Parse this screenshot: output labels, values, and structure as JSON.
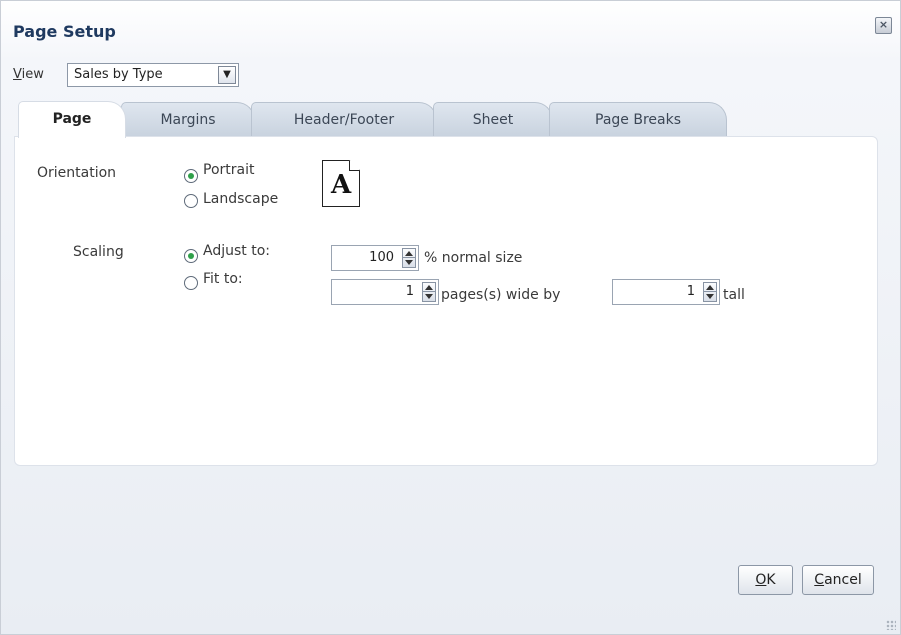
{
  "dialog": {
    "title": "Page Setup",
    "close_label": "×"
  },
  "view": {
    "label_prefix": "V",
    "label_rest": "iew",
    "selected": "Sales by Type",
    "dropdown_arrow": "chevron-down-icon"
  },
  "tabs": [
    {
      "label": "Page",
      "active": true
    },
    {
      "label": "Margins",
      "active": false
    },
    {
      "label": "Header/Footer",
      "active": false
    },
    {
      "label": "Sheet",
      "active": false
    },
    {
      "label": "Page Breaks",
      "active": false
    }
  ],
  "orientation": {
    "label": "Orientation",
    "options": [
      {
        "label": "Portrait",
        "checked": true
      },
      {
        "label": "Landscape",
        "checked": false
      }
    ],
    "preview_letter": "A"
  },
  "scaling": {
    "label": "Scaling",
    "adjust_to": {
      "label": "Adjust to:",
      "checked": true,
      "value": "100",
      "suffix": "% normal size"
    },
    "fit_to": {
      "label": "Fit to:",
      "checked": false,
      "wide_value": "1",
      "wide_suffix": "pages(s) wide by",
      "tall_value": "1",
      "tall_suffix": "tall"
    }
  },
  "buttons": {
    "ok_prefix": "O",
    "ok_rest": "K",
    "cancel_prefix": "C",
    "cancel_rest": "ancel"
  },
  "colors": {
    "title": "#1f3a60",
    "radio_checked": "#2fa04a"
  }
}
